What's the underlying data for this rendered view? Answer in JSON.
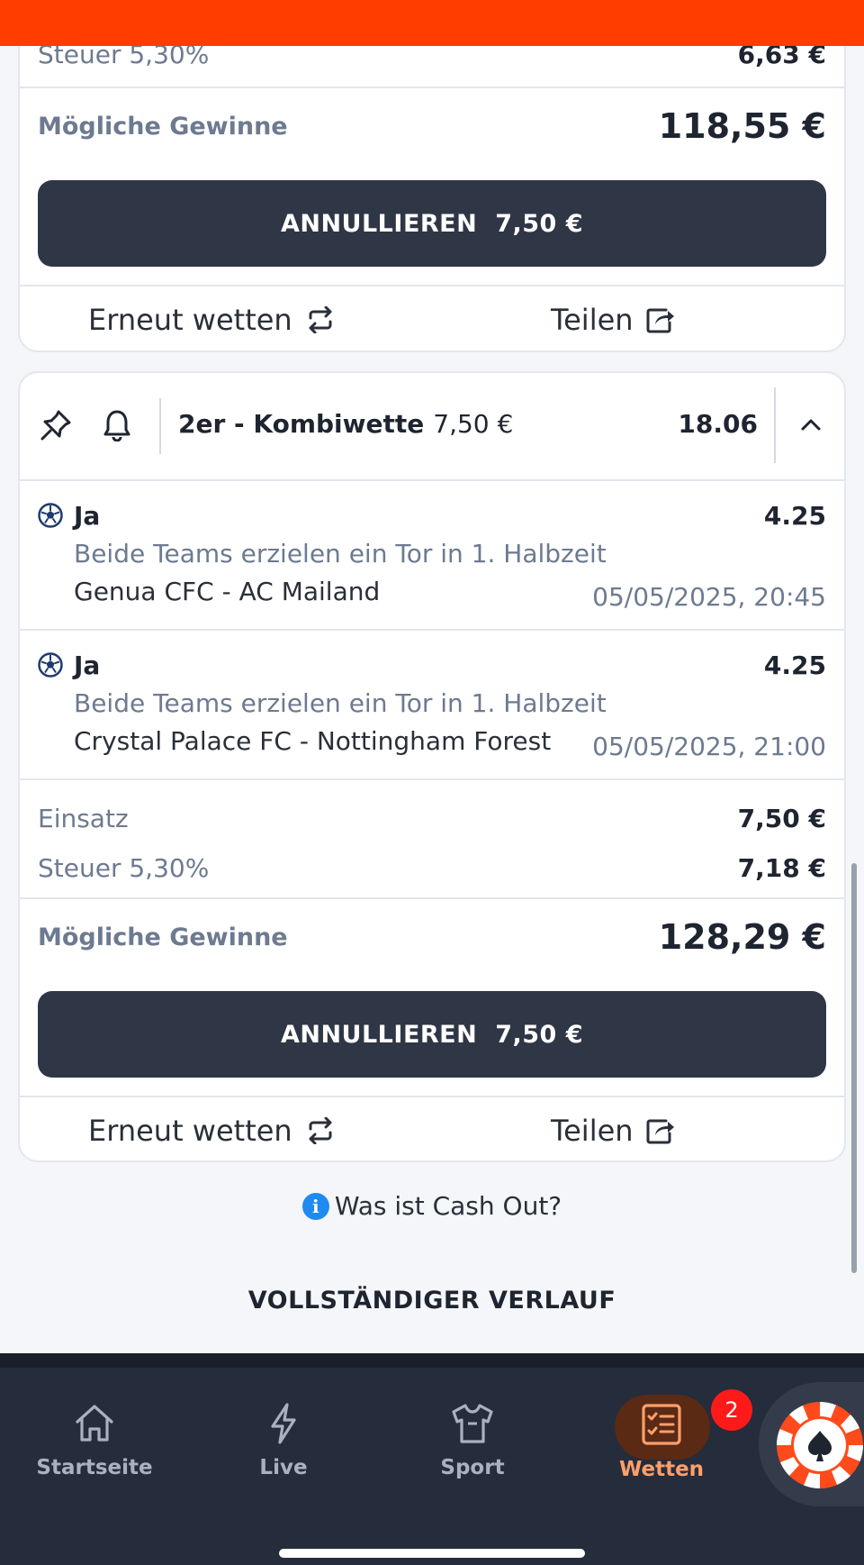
{
  "previous_bet": {
    "tax_label": "Steuer 5,30%",
    "tax_value": "6,63 €",
    "gains_label": "Mögliche Gewinne",
    "gains_value": "118,55 €",
    "cancel_label": "ANNULLIEREN",
    "cancel_amount": "7,50 €",
    "rebet_label": "Erneut wetten",
    "share_label": "Teilen"
  },
  "bet": {
    "type": "2er - Kombiwette",
    "stake": "7,50 €",
    "total_odds": "18.06",
    "selections": [
      {
        "pick": "Ja",
        "odds": "4.25",
        "market": "Beide Teams erzielen ein Tor in 1. Halbzeit",
        "event": "Genua CFC - AC Mailand",
        "date": "05/05/2025, 20:45"
      },
      {
        "pick": "Ja",
        "odds": "4.25",
        "market": "Beide Teams erzielen ein Tor in 1. Halbzeit",
        "event": "Crystal Palace FC - Nottingham Forest",
        "date": "05/05/2025, 21:00"
      }
    ],
    "stake_label": "Einsatz",
    "stake_value": "7,50 €",
    "tax_label": "Steuer 5,30%",
    "tax_value": "7,18 €",
    "gains_label": "Mögliche Gewinne",
    "gains_value": "128,29 €",
    "cancel_label": "ANNULLIEREN",
    "cancel_amount": "7,50 €",
    "rebet_label": "Erneut wetten",
    "share_label": "Teilen"
  },
  "cashout_info": "Was ist Cash Out?",
  "history_label": "VOLLSTÄNDIGER VERLAUF",
  "nav": {
    "items": [
      {
        "label": "Startseite",
        "icon": "home-icon"
      },
      {
        "label": "Live",
        "icon": "lightning-icon"
      },
      {
        "label": "Sport",
        "icon": "jersey-icon"
      },
      {
        "label": "Wetten",
        "icon": "betslip-icon"
      }
    ],
    "badge": "2",
    "active": "Wetten"
  },
  "colors": {
    "accent": "#ff3d00",
    "button_dark": "#2f3645",
    "nav_bg": "#252c3b",
    "nav_active": "#ff9f6a",
    "badge": "#ff1a1a",
    "info_blue": "#1f8bf0"
  }
}
